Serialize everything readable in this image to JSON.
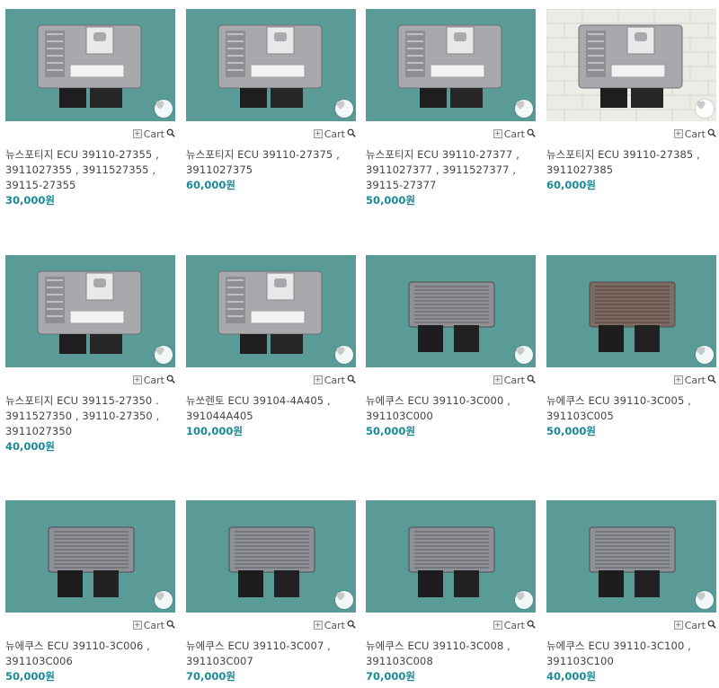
{
  "colors": {
    "price": "#1a8a96",
    "bg_teal": "#5a9b98",
    "bg_brick": "#ecebe6"
  },
  "cart_label": "Cart",
  "products": [
    {
      "title": "뉴스포티지 ECU 39110-27355 ,\n3911027355 , 3911527355 ,\n39115-27355",
      "price": "30,000원",
      "bg": "teal",
      "unit": "bosch"
    },
    {
      "title": "뉴스포티지 ECU 39110-27375 ,\n3911027375",
      "price": "60,000원",
      "bg": "teal",
      "unit": "bosch"
    },
    {
      "title": "뉴스포티지 ECU 39110-27377 ,\n3911027377 , 3911527377 ,\n39115-27377",
      "price": "50,000원",
      "bg": "teal",
      "unit": "bosch"
    },
    {
      "title": "뉴스포티지 ECU 39110-27385 ,\n3911027385",
      "price": "60,000원",
      "bg": "brick",
      "unit": "bosch"
    },
    {
      "title": "뉴스포티지 ECU 39115-27350 .\n3911527350 , 39110-27350 ,\n3911027350",
      "price": "40,000원",
      "bg": "teal",
      "unit": "bosch"
    },
    {
      "title": "뉴쏘렌토 ECU 39104-4A405 ,\n391044A405",
      "price": "100,000원",
      "bg": "teal",
      "unit": "bosch"
    },
    {
      "title": "뉴에쿠스 ECU 39110-3C000 ,\n391103C000",
      "price": "50,000원",
      "bg": "teal",
      "unit": "finned"
    },
    {
      "title": "뉴에쿠스 ECU 39110-3C005 ,\n391103C005",
      "price": "50,000원",
      "bg": "teal",
      "unit": "finned-brown"
    },
    {
      "title": "뉴에쿠스 ECU 39110-3C006 ,\n391103C006",
      "price": "50,000원",
      "bg": "teal",
      "unit": "finned"
    },
    {
      "title": "뉴에쿠스 ECU 39110-3C007 ,\n391103C007",
      "price": "70,000원",
      "bg": "teal",
      "unit": "finned"
    },
    {
      "title": "뉴에쿠스 ECU 39110-3C008 ,\n391103C008",
      "price": "70,000원",
      "bg": "teal",
      "unit": "finned"
    },
    {
      "title": "뉴에쿠스 ECU 39110-3C100 ,\n391103C100",
      "price": "40,000원",
      "bg": "teal",
      "unit": "finned"
    }
  ]
}
